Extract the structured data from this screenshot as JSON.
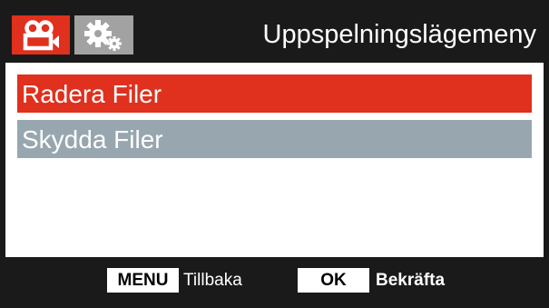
{
  "header": {
    "title": "Uppspelningslägemeny",
    "tabs": [
      {
        "icon": "video-camera-icon",
        "active": true,
        "color": "#e0301e"
      },
      {
        "icon": "gears-icon",
        "active": false,
        "color": "#a2a2a2"
      }
    ]
  },
  "menu": {
    "items": [
      {
        "label": "Radera Filer",
        "selected": true,
        "color": "#e0301e"
      },
      {
        "label": "Skydda Filer",
        "selected": false,
        "color": "#98a6b0"
      }
    ]
  },
  "footer": {
    "menu_key": "MENU",
    "menu_label": "Tillbaka",
    "ok_key": "OK",
    "ok_label": "Bekräfta"
  }
}
